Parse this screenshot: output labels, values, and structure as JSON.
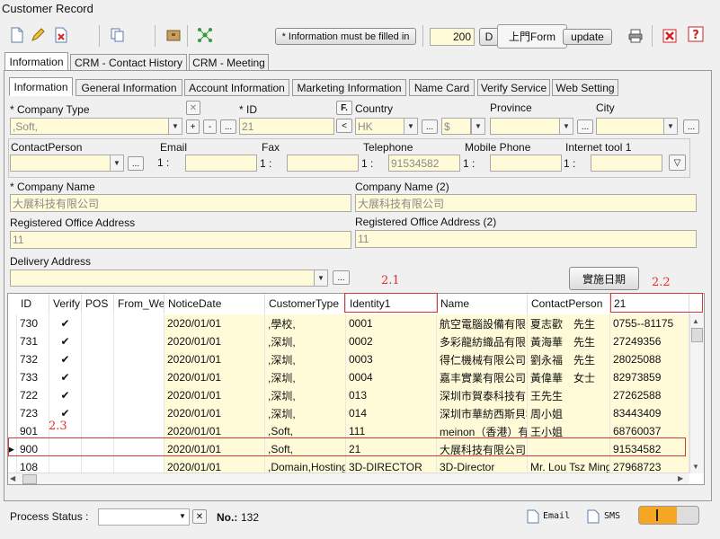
{
  "window": {
    "title": "Customer Record"
  },
  "toolbar": {
    "required_note": "* Information must be filled in",
    "page_size": "200",
    "d_button": "D",
    "form_button": "上門Form",
    "update_button": "update"
  },
  "main_tabs": [
    "Information",
    "CRM - Contact History",
    "CRM - Meeting"
  ],
  "sub_tabs": [
    "Information",
    "General Information",
    "Account Information",
    "Marketing Information",
    "Name Card",
    "Verify Service",
    "Web Setting"
  ],
  "form": {
    "company_type_label": "* Company Type",
    "company_type_value": ",Soft,",
    "id_label": "* ID",
    "id_value": "21",
    "f_button": "F.",
    "country_label": "Country",
    "country_value": "HK",
    "currency_value": "$",
    "province_label": "Province",
    "city_label": "City",
    "contact_person_label": "ContactPerson",
    "email_label": "Email",
    "fax_label": "Fax",
    "telephone_label": "Telephone",
    "mobile_label": "Mobile Phone",
    "internet_label": "Internet tool 1",
    "index_prefix": "1 :",
    "telephone_value": "91534582",
    "company_name_label": "* Company Name",
    "company_name_value": "大展科技有限公司",
    "company_name2_label": "Company Name (2)",
    "company_name2_value": "大展科技有限公司",
    "reg_addr_label": "Registered Office Address",
    "reg_addr_value": "11",
    "reg_addr2_label": "Registered Office Address (2)",
    "reg_addr2_value": "11",
    "delivery_label": "Delivery Address",
    "date_button": "實施日期",
    "plus": "+",
    "minus": "-",
    "ellipsis": "...",
    "back": "<"
  },
  "annotations": {
    "a21": "2.1",
    "a22": "2.2",
    "a23": "2.3"
  },
  "grid": {
    "filter_value": "21",
    "columns": [
      "ID",
      "Verify",
      "POS",
      "From_Web",
      "NoticeDate",
      "CustomerType",
      "Identity1",
      "Name",
      "ContactPerson",
      ""
    ],
    "rows": [
      {
        "id": "730",
        "verify": "✔",
        "date": "2020/01/01",
        "type": ",學校,",
        "identity": "0001",
        "name": "航空電腦設備有限公司",
        "contact": "夏志歡　先生",
        "phone": "0755--81175"
      },
      {
        "id": "731",
        "verify": "✔",
        "date": "2020/01/01",
        "type": ",深圳,",
        "identity": "0002",
        "name": "多彩龍紡織品有限公司",
        "contact": "黃海華　先生",
        "phone": "27249356"
      },
      {
        "id": "732",
        "verify": "✔",
        "date": "2020/01/01",
        "type": ",深圳,",
        "identity": "0003",
        "name": "得仁機械有限公司",
        "contact": "劉永福　先生",
        "phone": "28025088"
      },
      {
        "id": "733",
        "verify": "✔",
        "date": "2020/01/01",
        "type": ",深圳,",
        "identity": "0004",
        "name": "嘉丰實業有限公司",
        "contact": "黃偉華　女士",
        "phone": "82973859"
      },
      {
        "id": "722",
        "verify": "✔",
        "date": "2020/01/01",
        "type": ",深圳,",
        "identity": "013",
        "name": "深圳市賀泰科技有限公司",
        "contact": "王先生",
        "phone": "27262588"
      },
      {
        "id": "723",
        "verify": "✔",
        "date": "2020/01/01",
        "type": ",深圳,",
        "identity": "014",
        "name": "深圳市華紡西斯貝科技",
        "contact": "周小姐",
        "phone": "83443409"
      },
      {
        "id": "901",
        "verify": "",
        "date": "2020/01/01",
        "type": ",Soft,",
        "identity": "111",
        "name": "meinon（香港）有限公司",
        "contact": "王小姐",
        "phone": "68760037"
      },
      {
        "id": "900",
        "verify": "",
        "date": "2020/01/01",
        "type": ",Soft,",
        "identity": "21",
        "name": "大展科技有限公司",
        "contact": "",
        "phone": "91534582"
      },
      {
        "id": "108",
        "verify": "",
        "date": "2020/01/01",
        "type": ",Domain,Hosting",
        "identity": "3D-DIRECTOR",
        "name": "3D-Director",
        "contact": "Mr. Lou Tsz Ming",
        "phone": "27968723"
      }
    ]
  },
  "status": {
    "process_label": "Process Status :",
    "no_label": "No.:",
    "no_value": "132",
    "email": "Email",
    "sms": "SMS"
  },
  "colors": {
    "field": "#fffbd9",
    "annotation": "#e03030",
    "toggle": "#f5a623"
  }
}
